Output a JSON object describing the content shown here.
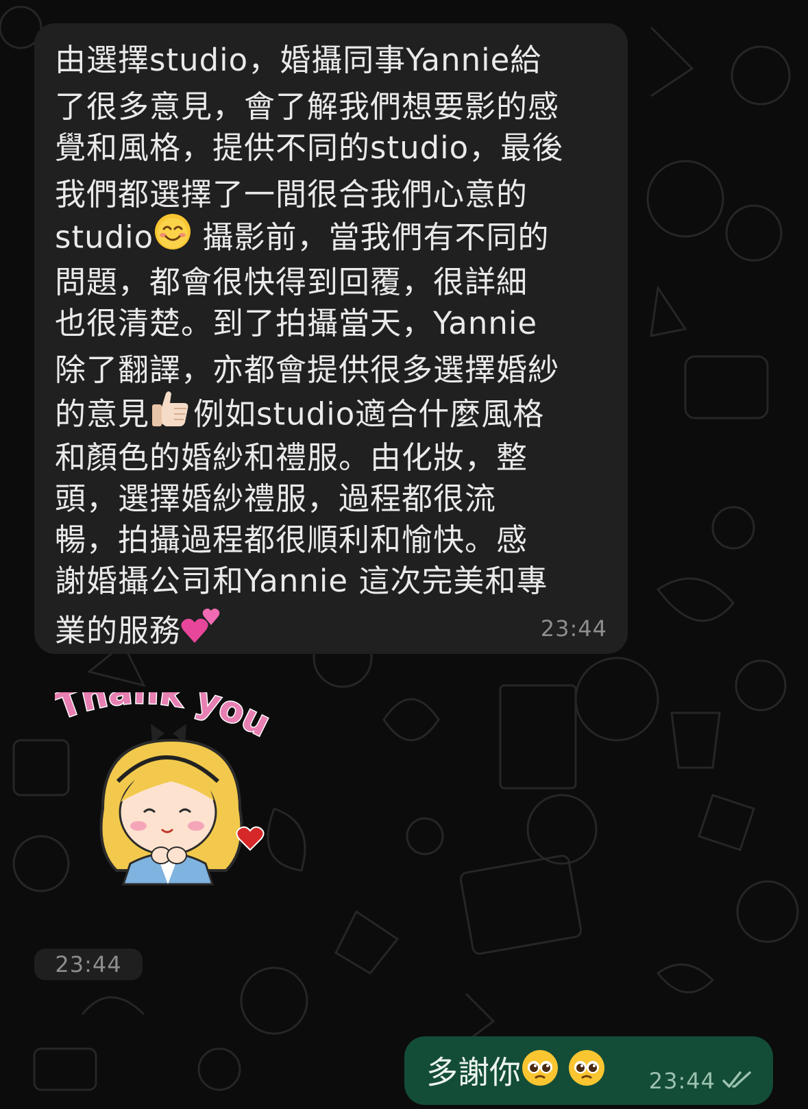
{
  "incoming_message": {
    "lines": [
      "由選擇studio，婚攝同事Yannie給",
      "了很多意見，會了解我們想要影的感",
      "覺和風格，提供不同的studio，最後",
      "我們都選擇了一間很合我們心意的",
      " 攝影前，當我們有不同的",
      "問題，都會很快得到回覆，很詳細",
      "也很清楚。到了拍攝當天，Yannie",
      "除了翻譯，亦都會提供很多選擇婚紗",
      "例如studio適合什麼風格",
      "和顏色的婚紗和禮服。由化妝，整",
      "頭，選擇婚紗禮服，過程都很流",
      "暢，拍攝過程都很順利和愉快。感",
      "謝婚攝公司和Yannie 這次完美和專",
      "業的服務"
    ],
    "line5_prefix": "studio",
    "line9_prefix": "的意見",
    "time": "23:44"
  },
  "sticker": {
    "text": "Thank you",
    "time": "23:44"
  },
  "outgoing_message": {
    "text": "多謝你",
    "time": "23:44",
    "status_icon": "double-check-icon"
  },
  "colors": {
    "background": "#0c0c0c",
    "incoming_bubble": "#202020",
    "outgoing_bubble": "#144d37",
    "sticker_text": "#e77fb2",
    "meta_text": "#8e8e8e"
  }
}
